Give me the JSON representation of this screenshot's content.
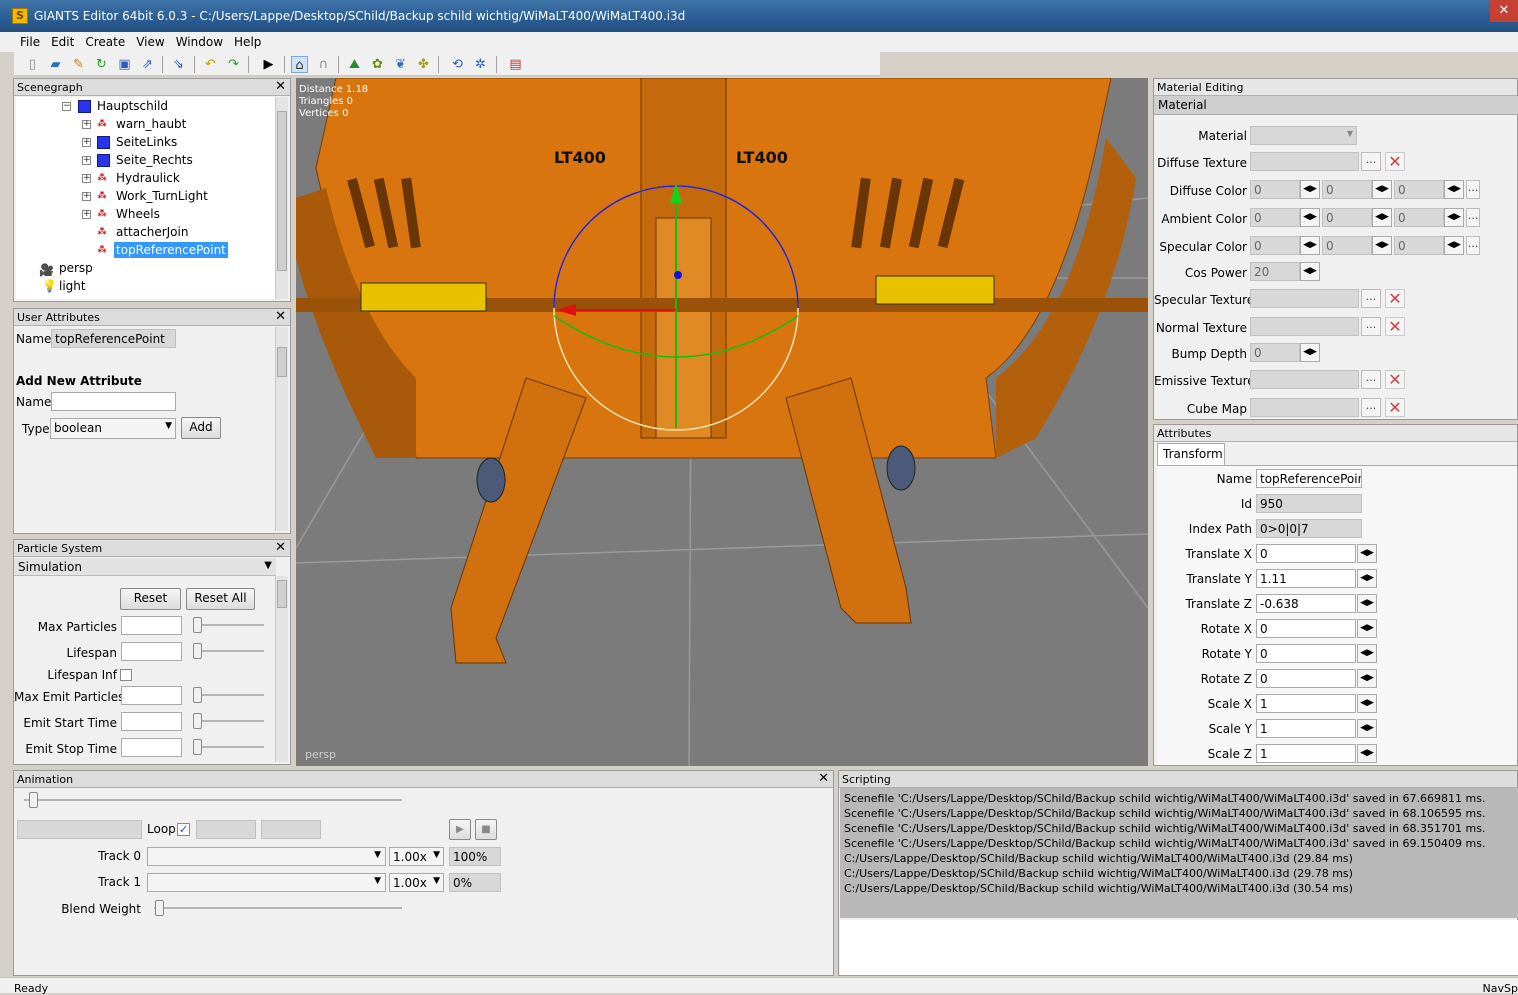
{
  "window": {
    "title": "GIANTS Editor 64bit 6.0.3 - C:/Users/Lappe/Desktop/SChild/Backup schild wichtig/WiMaLT400/WiMaLT400.i3d",
    "icon": "giants-app-icon"
  },
  "menu": [
    "File",
    "Edit",
    "Create",
    "View",
    "Window",
    "Help"
  ],
  "toolbar_icons": [
    "new-file-icon",
    "open-file-icon",
    "edit-icon",
    "refresh-icon",
    "save-icon",
    "export-icon",
    "import-icon",
    "undo-icon",
    "redo-icon",
    "play-icon",
    "home-icon",
    "magnet-icon",
    "terrain-icon",
    "paint-icon",
    "foliage-icon",
    "decal-icon",
    "spline-icon",
    "navigation-icon",
    "settings-icon",
    "delete-icon"
  ],
  "scenegraph": {
    "title": "Scenegraph",
    "items": [
      {
        "label": "Hauptschild",
        "icon": "cube-icon"
      },
      {
        "label": "warn_haubt",
        "icon": "transform-group-icon"
      },
      {
        "label": "SeiteLinks",
        "icon": "cube-icon"
      },
      {
        "label": "Seite_Rechts",
        "icon": "cube-icon"
      },
      {
        "label": "Hydraulick",
        "icon": "transform-group-icon"
      },
      {
        "label": "Work_TurnLight",
        "icon": "transform-group-icon"
      },
      {
        "label": "Wheels",
        "icon": "transform-group-icon"
      },
      {
        "label": "attacherJoin",
        "icon": "transform-group-icon"
      },
      {
        "label": "topReferencePoint",
        "icon": "transform-group-icon"
      },
      {
        "label": "persp",
        "icon": "camera-icon"
      },
      {
        "label": "light",
        "icon": "light-icon"
      }
    ]
  },
  "user_attributes": {
    "title": "User Attributes",
    "name_label": "Name",
    "name_value": "topReferencePoint",
    "add_title": "Add New Attribute",
    "new_name_label": "Name",
    "new_name_value": "",
    "type_label": "Type",
    "type_value": "boolean",
    "add_button": "Add"
  },
  "particle_system": {
    "title": "Particle System",
    "section": "Simulation",
    "reset": "Reset",
    "reset_all": "Reset All",
    "fields": [
      "Max Particles",
      "Lifespan",
      "Lifespan Inf",
      "Max Emit Particles",
      "Emit Start Time",
      "Emit Stop Time"
    ]
  },
  "viewport": {
    "stats": [
      "Distance 1.18",
      "Triangles 0",
      "Vertices 0"
    ],
    "camera": "persp",
    "decal_text": "LT400"
  },
  "material_editing": {
    "title": "Material Editing",
    "section": "Material",
    "material_label": "Material",
    "material_value": "",
    "diffuse_texture": "Diffuse Texture",
    "diffuse_color": {
      "label": "Diffuse Color",
      "values": [
        "0",
        "0",
        "0"
      ]
    },
    "ambient_color": {
      "label": "Ambient Color",
      "values": [
        "0",
        "0",
        "0"
      ]
    },
    "specular_color": {
      "label": "Specular Color",
      "values": [
        "0",
        "0",
        "0"
      ]
    },
    "cos_power": {
      "label": "Cos Power",
      "value": "20"
    },
    "specular_texture": "Specular Texture",
    "normal_texture": "Normal Texture",
    "bump_depth": {
      "label": "Bump Depth",
      "value": "0"
    },
    "emissive_texture": "Emissive Texture",
    "cube_map": "Cube Map",
    "ellipsis": "...",
    "clear_icon": "clear-x-icon"
  },
  "attributes": {
    "title": "Attributes",
    "tab": "Transform",
    "rows": [
      {
        "label": "Name",
        "value": "topReferencePoint",
        "kind": "name"
      },
      {
        "label": "Id",
        "value": "950",
        "kind": "gray"
      },
      {
        "label": "Index Path",
        "value": "0>0|0|7",
        "kind": "gray"
      },
      {
        "label": "Translate X",
        "value": "0",
        "kind": "spin"
      },
      {
        "label": "Translate Y",
        "value": "1.11",
        "kind": "spin"
      },
      {
        "label": "Translate Z",
        "value": "-0.638",
        "kind": "spin"
      },
      {
        "label": "Rotate X",
        "value": "0",
        "kind": "spin"
      },
      {
        "label": "Rotate Y",
        "value": "0",
        "kind": "spin"
      },
      {
        "label": "Rotate Z",
        "value": "0",
        "kind": "spin"
      },
      {
        "label": "Scale X",
        "value": "1",
        "kind": "spin"
      },
      {
        "label": "Scale Y",
        "value": "1",
        "kind": "spin"
      },
      {
        "label": "Scale Z",
        "value": "1",
        "kind": "spin"
      }
    ]
  },
  "animation": {
    "title": "Animation",
    "loop_label": "Loop",
    "loop_checked": true,
    "track0_label": "Track 0",
    "track0_speed": "1.00x",
    "track0_weight": "100%",
    "track1_label": "Track 1",
    "track1_speed": "1.00x",
    "track1_weight": "0%",
    "blend_label": "Blend Weight"
  },
  "scripting": {
    "title": "Scripting",
    "lines": [
      "Scenefile 'C:/Users/Lappe/Desktop/SChild/Backup schild wichtig/WiMaLT400/WiMaLT400.i3d' saved in 67.669811 ms.",
      "Scenefile 'C:/Users/Lappe/Desktop/SChild/Backup schild wichtig/WiMaLT400/WiMaLT400.i3d' saved in 68.106595 ms.",
      "Scenefile 'C:/Users/Lappe/Desktop/SChild/Backup schild wichtig/WiMaLT400/WiMaLT400.i3d' saved in 68.351701 ms.",
      "Scenefile 'C:/Users/Lappe/Desktop/SChild/Backup schild wichtig/WiMaLT400/WiMaLT400.i3d' saved in 69.150409 ms.",
      "C:/Users/Lappe/Desktop/SChild/Backup schild wichtig/WiMaLT400/WiMaLT400.i3d (29.84 ms)",
      "C:/Users/Lappe/Desktop/SChild/Backup schild wichtig/WiMaLT400/WiMaLT400.i3d (29.78 ms)",
      "C:/Users/Lappe/Desktop/SChild/Backup schild wichtig/WiMaLT400/WiMaLT400.i3d (30.54 ms)"
    ]
  },
  "status": {
    "left": "Ready",
    "right": "NavSp"
  },
  "colors": {
    "titlebar": "#2b5e96",
    "selection": "#3399ff",
    "object_orange": "#d8750f",
    "viewport_bg": "#7b7b7b"
  }
}
